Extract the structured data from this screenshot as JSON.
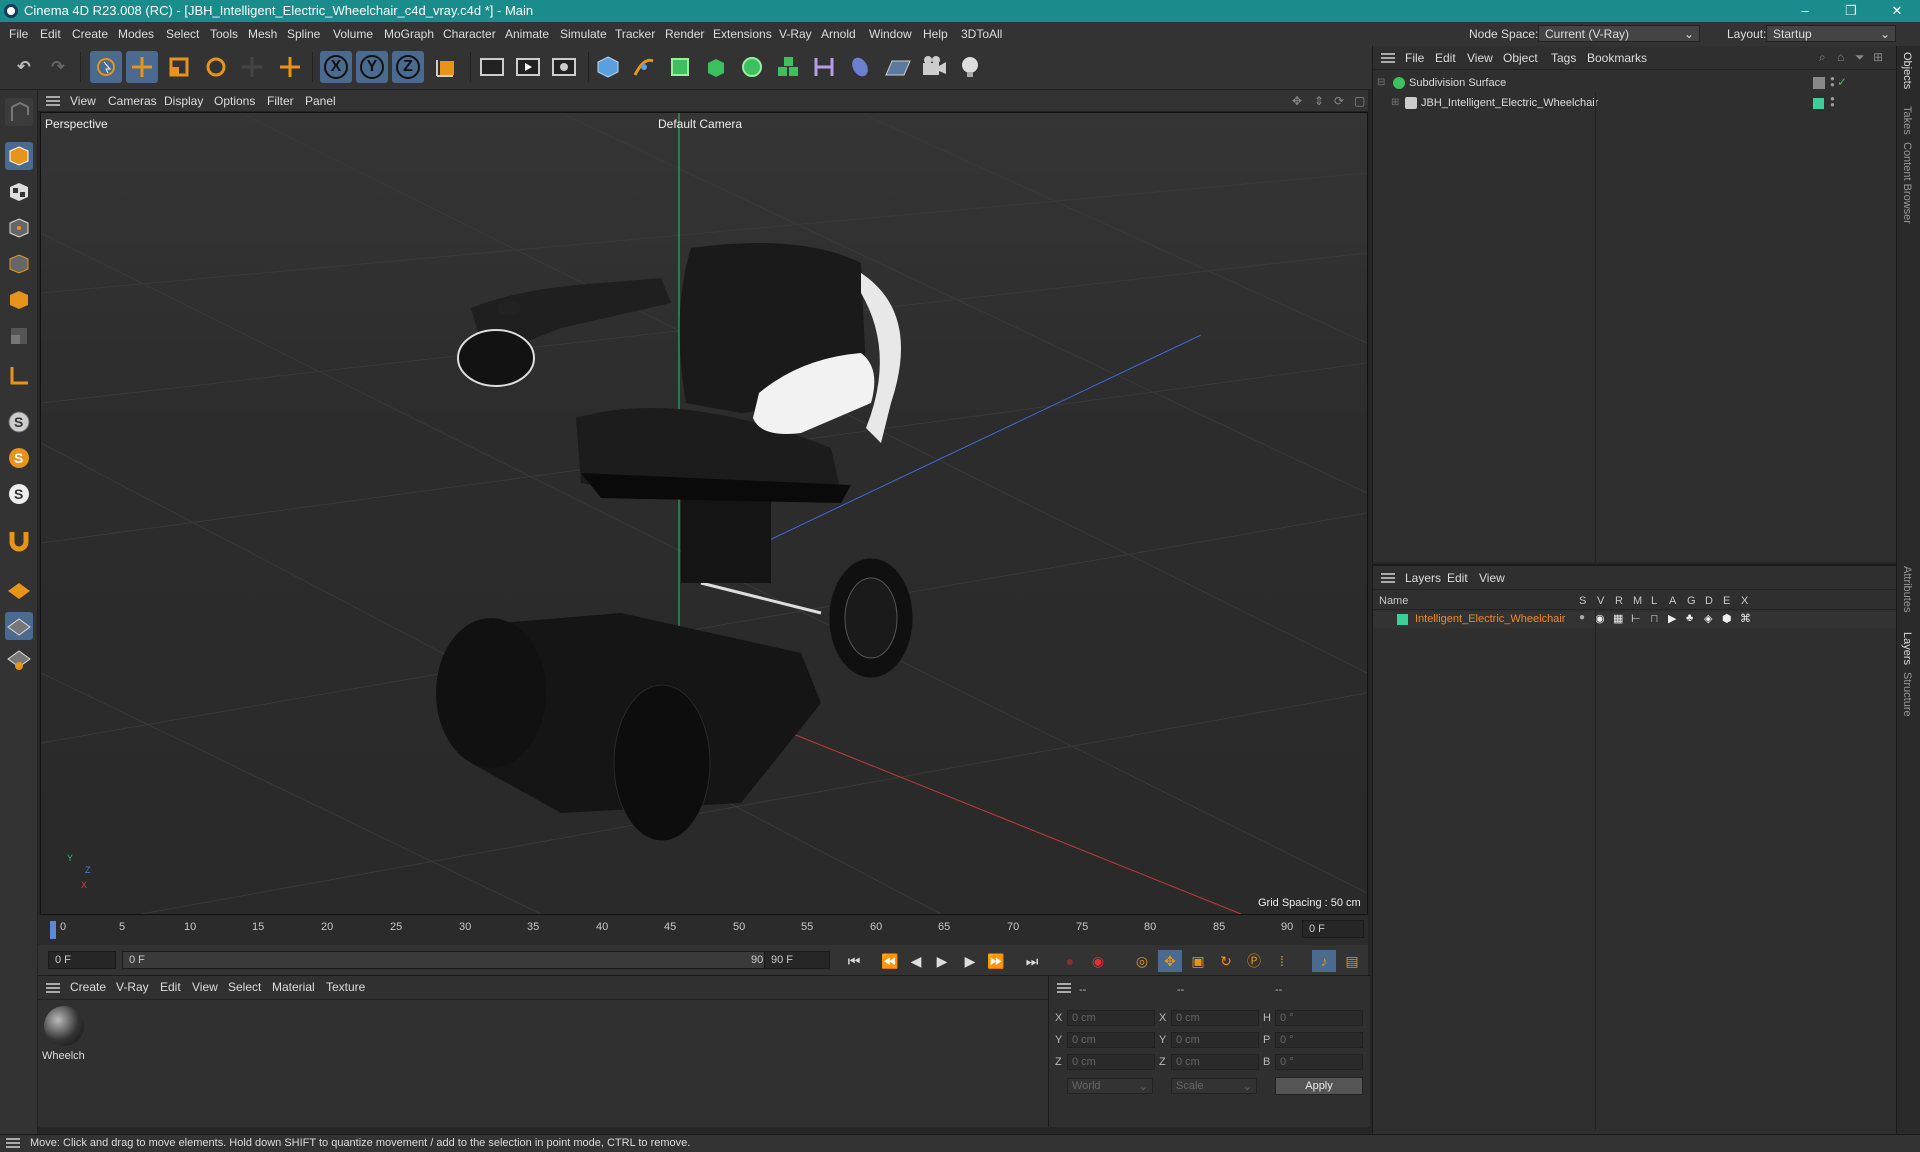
{
  "window": {
    "title": "Cinema 4D R23.008 (RC) - [JBH_Intelligent_Electric_Wheelchair_c4d_vray.c4d *] - Main",
    "controls": [
      "–",
      "❐",
      "✕"
    ]
  },
  "menubar": {
    "items": [
      "File",
      "Edit",
      "Create",
      "Modes",
      "Select",
      "Tools",
      "Mesh",
      "Spline",
      "Volume",
      "MoGraph",
      "Character",
      "Animate",
      "Simulate",
      "Tracker",
      "Render",
      "Extensions",
      "V-Ray",
      "Arnold",
      "Window",
      "Help",
      "3DToAll"
    ],
    "node_space_label": "Node Space:",
    "node_space_value": "Current (V-Ray)",
    "layout_label": "Layout:",
    "layout_value": "Startup"
  },
  "toolbar": {
    "axis_x": "X",
    "axis_y": "Y",
    "axis_z": "Z"
  },
  "viewport": {
    "menu": [
      "View",
      "Cameras",
      "Display",
      "Options",
      "Filter",
      "Panel"
    ],
    "view_name": "Perspective",
    "camera": "Default Camera",
    "grid_spacing": "Grid Spacing : 50 cm",
    "axis_labels": {
      "y": "Y",
      "z": "Z",
      "x": "X"
    }
  },
  "timeline": {
    "ticks": [
      "0",
      "5",
      "10",
      "15",
      "20",
      "25",
      "30",
      "35",
      "40",
      "45",
      "50",
      "55",
      "60",
      "65",
      "70",
      "75",
      "80",
      "85",
      "90"
    ],
    "current_frame": "0 F"
  },
  "transport": {
    "start_field": "0 F",
    "range_start": "0 F",
    "range_end": "90 F",
    "end_field": "90 F"
  },
  "material_manager": {
    "menu": [
      "Create",
      "V-Ray",
      "Edit",
      "View",
      "Select",
      "Material",
      "Texture"
    ],
    "material_name": "Wheelch"
  },
  "coordinates": {
    "headers": [
      "--",
      "--",
      "--"
    ],
    "rows": [
      {
        "l1": "X",
        "v1": "0 cm",
        "l2": "X",
        "v2": "0 cm",
        "l3": "H",
        "v3": "0 °"
      },
      {
        "l1": "Y",
        "v1": "0 cm",
        "l2": "Y",
        "v2": "0 cm",
        "l3": "P",
        "v3": "0 °"
      },
      {
        "l1": "Z",
        "v1": "0 cm",
        "l2": "Z",
        "v2": "0 cm",
        "l3": "B",
        "v3": "0 °"
      }
    ],
    "mode1": "World",
    "mode2": "Scale",
    "apply_label": "Apply"
  },
  "object_manager": {
    "menu": [
      "File",
      "Edit",
      "View",
      "Object",
      "Tags",
      "Bookmarks"
    ],
    "objects": [
      {
        "name": "Subdivision Surface"
      },
      {
        "name": "JBH_Intelligent_Electric_Wheelchair"
      }
    ]
  },
  "layer_manager": {
    "menu": [
      "Layers",
      "Edit",
      "View"
    ],
    "columns": [
      "Name",
      "S",
      "V",
      "R",
      "M",
      "L",
      "A",
      "G",
      "D",
      "E",
      "X"
    ],
    "layers": [
      {
        "name": "Intelligent_Electric_Wheelchair",
        "color": "#3ccf9a"
      }
    ]
  },
  "side_tabs": [
    "Objects",
    "Takes",
    "Content Browser",
    "Attributes",
    "Layers",
    "Structure"
  ],
  "status": {
    "text": "Move: Click and drag to move elements. Hold down SHIFT to quantize movement / add to the selection in point mode, CTRL to remove."
  },
  "colors": {
    "titlebar": "#1b8c8c",
    "accent": "#4a6a8f",
    "layer_name": "#f08a24",
    "orange_icon": "#e8931a"
  }
}
